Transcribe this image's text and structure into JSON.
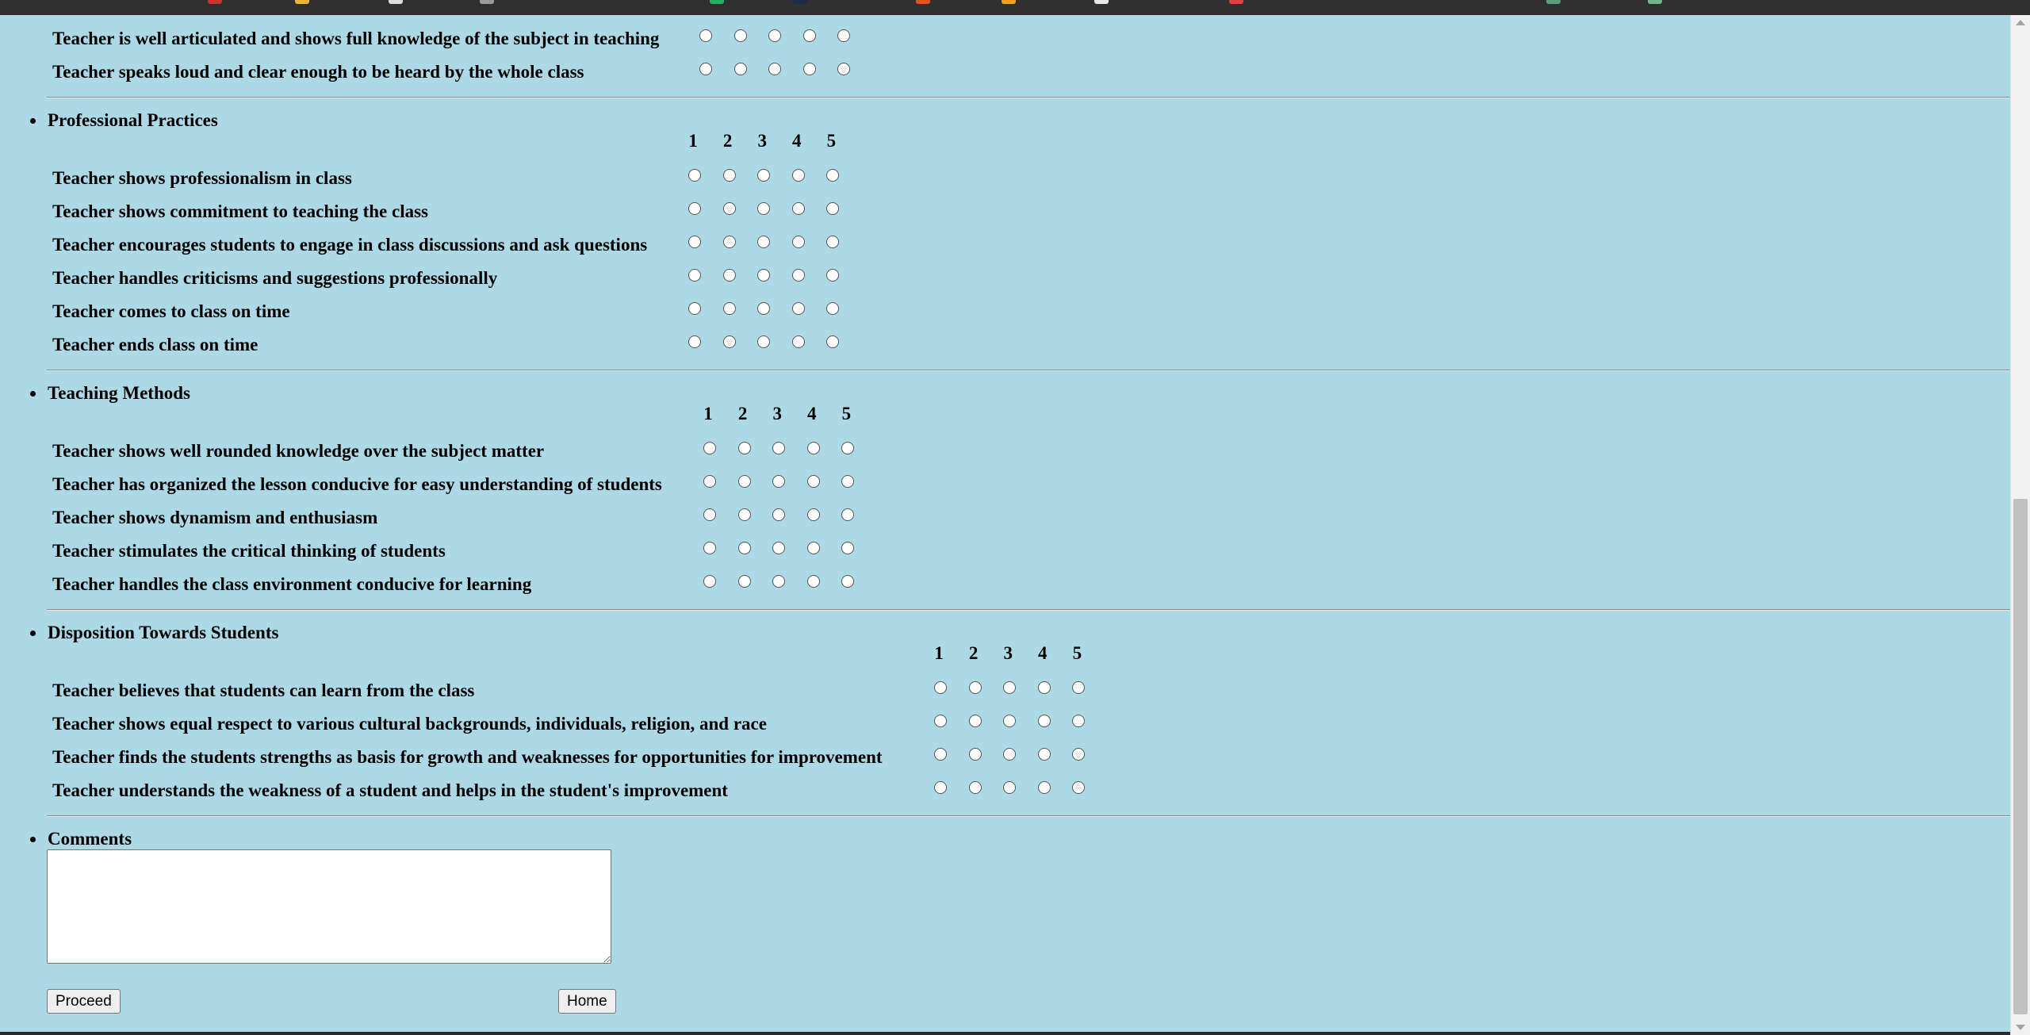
{
  "sections": [
    {
      "title": "",
      "questions": [
        "Teacher is well articulated and shows full knowledge of the subject in teaching",
        "Teacher speaks loud and clear enough to be heard by the whole class"
      ]
    },
    {
      "title": "Professional Practices",
      "scale": [
        "1",
        "2",
        "3",
        "4",
        "5"
      ],
      "questions": [
        "Teacher shows professionalism in class",
        "Teacher shows commitment to teaching the class",
        "Teacher encourages students to engage in class discussions and ask questions",
        "Teacher handles criticisms and suggestions professionally",
        "Teacher comes to class on time",
        "Teacher ends class on time"
      ]
    },
    {
      "title": "Teaching Methods",
      "scale": [
        "1",
        "2",
        "3",
        "4",
        "5"
      ],
      "questions": [
        "Teacher shows well rounded knowledge over the subject matter",
        "Teacher has organized the lesson conducive for easy understanding of students",
        "Teacher shows dynamism and enthusiasm",
        "Teacher stimulates the critical thinking of students",
        "Teacher handles the class environment conducive for learning"
      ]
    },
    {
      "title": "Disposition Towards Students",
      "scale": [
        "1",
        "2",
        "3",
        "4",
        "5"
      ],
      "questions": [
        "Teacher believes that students can learn from the class",
        "Teacher shows equal respect to various cultural backgrounds, individuals, religion, and race",
        "Teacher finds the students strengths as basis for growth and weaknesses for opportunities for improvement",
        "Teacher understands the weakness of a student and helps in the student's improvement"
      ]
    }
  ],
  "comments": {
    "title": "Comments",
    "value": ""
  },
  "buttons": {
    "proceed": "Proceed",
    "home": "Home"
  }
}
